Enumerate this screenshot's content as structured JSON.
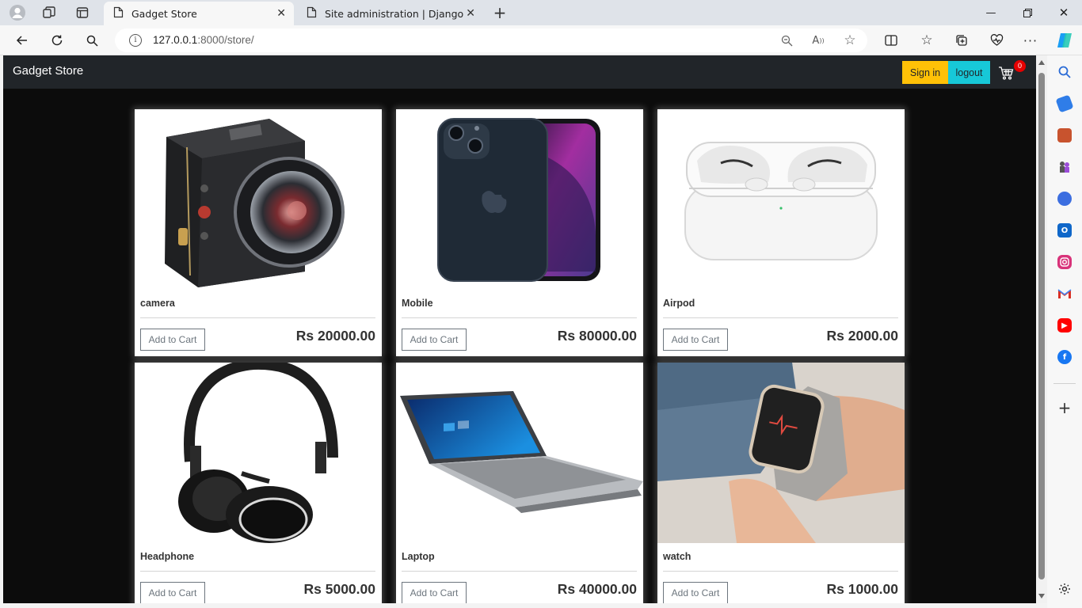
{
  "browser": {
    "tabs": [
      {
        "title": "Gadget Store",
        "active": true
      },
      {
        "title": "Site administration | Django site a",
        "active": false
      }
    ],
    "address": {
      "host": "127.0.0.1",
      "rest": ":8000/store/"
    }
  },
  "store": {
    "brand": "Gadget Store",
    "signin_label": "Sign in",
    "logout_label": "logout",
    "cart_count": "0",
    "add_label": "Add to Cart",
    "products": [
      {
        "name": "camera",
        "price": "Rs 20000.00"
      },
      {
        "name": "Mobile",
        "price": "Rs 80000.00"
      },
      {
        "name": "Airpod",
        "price": "Rs 2000.00"
      },
      {
        "name": "Headphone",
        "price": "Rs 5000.00"
      },
      {
        "name": "Laptop",
        "price": "Rs 40000.00"
      },
      {
        "name": "watch",
        "price": "Rs 1000.00"
      }
    ]
  },
  "colors": {
    "navbar": "#212529",
    "signin": "#ffc107",
    "logout": "#17c8d8",
    "badge": "#e60000",
    "page_bg": "#0c0c0c"
  }
}
